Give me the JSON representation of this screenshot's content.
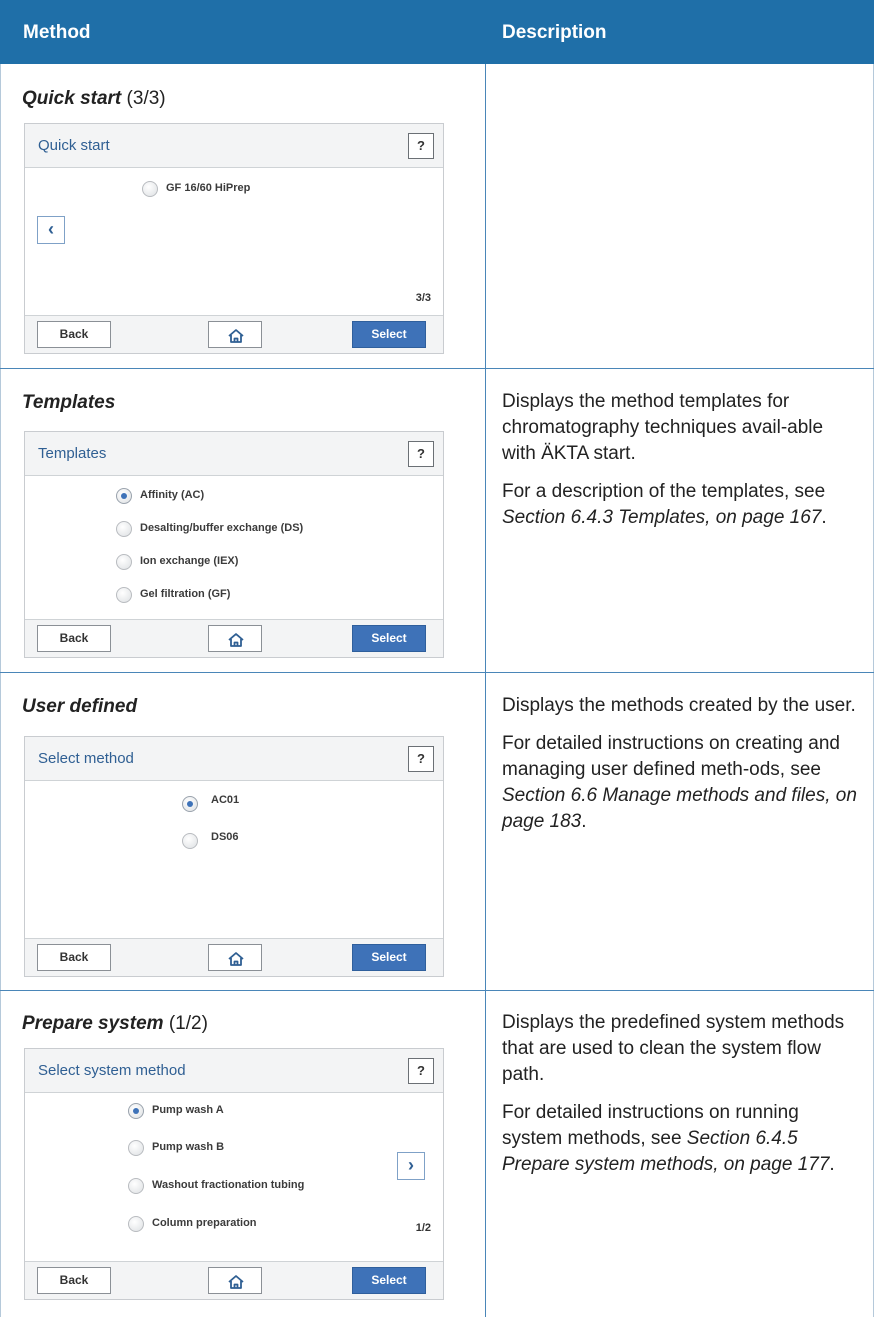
{
  "header": {
    "col_method": "Method",
    "col_description": "Description"
  },
  "footer_buttons": {
    "back": "Back",
    "select": "Select",
    "help": "?"
  },
  "rows": [
    {
      "title_bold": "Quick start",
      "title_suffix": " (3/3)",
      "screen": {
        "title": "Quick start",
        "options": [
          {
            "label": "GF 16/60 HiPrep",
            "selected": false
          }
        ],
        "nav_icon": "chevron-left-icon",
        "nav_glyph": "‹",
        "page": "3/3"
      },
      "description": []
    },
    {
      "title_bold": "Templates",
      "title_suffix": "",
      "screen": {
        "title": "Templates",
        "options": [
          {
            "label": "Affinity (AC)",
            "selected": true
          },
          {
            "label": "Desalting/buffer exchange (DS)",
            "selected": false
          },
          {
            "label": "Ion exchange (IEX)",
            "selected": false
          },
          {
            "label": "Gel filtration (GF)",
            "selected": false
          }
        ]
      },
      "description": [
        {
          "text": "Displays the method templates for chromatography techniques avail-able with ÄKTA start.",
          "ref": "",
          "tail": ""
        },
        {
          "text": "For a description of the templates, see ",
          "ref": "Section 6.4.3 Templates, on page 167",
          "tail": "."
        }
      ]
    },
    {
      "title_bold": "User defined",
      "title_suffix": "",
      "screen": {
        "title": "Select method",
        "options": [
          {
            "label": "AC01",
            "selected": true
          },
          {
            "label": "DS06",
            "selected": false
          }
        ]
      },
      "description": [
        {
          "text": "Displays the methods created by the user.",
          "ref": "",
          "tail": ""
        },
        {
          "text": "For detailed instructions on creating and managing user defined meth-ods, see ",
          "ref": "Section 6.6 Manage methods and files, on page 183",
          "tail": "."
        }
      ]
    },
    {
      "title_bold": "Prepare system",
      "title_suffix": " (1/2)",
      "screen": {
        "title": "Select system method",
        "options": [
          {
            "label": "Pump wash A",
            "selected": true
          },
          {
            "label": "Pump wash B",
            "selected": false
          },
          {
            "label": "Washout fractionation tubing",
            "selected": false
          },
          {
            "label": "Column preparation",
            "selected": false
          }
        ],
        "nav_icon": "chevron-right-icon",
        "nav_glyph": "›",
        "page": "1/2"
      },
      "description": [
        {
          "text": "Displays the predefined system methods that are used to clean the system flow path.",
          "ref": "",
          "tail": ""
        },
        {
          "text": "For detailed instructions on running system methods, see ",
          "ref": "Section 6.4.5 Prepare system methods, on page 177",
          "tail": "."
        }
      ]
    }
  ],
  "colors": {
    "header_bg": "#1f6fa8",
    "accent": "#3e72b8",
    "rule": "#4a86b8"
  }
}
